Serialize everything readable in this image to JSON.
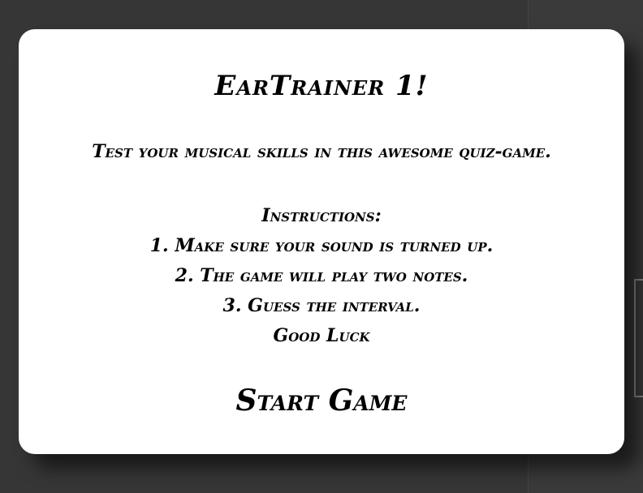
{
  "game": {
    "title": "EarTrainer 1!",
    "tagline": "Test your musical skills in this awesome quiz-game.",
    "instructions": {
      "heading": "Instructions:",
      "steps": [
        "1. Make sure your sound is turned up.",
        "2. The game will play two notes.",
        "3. Guess the interval."
      ],
      "closing": "Good Luck"
    },
    "start_label": "Start Game"
  },
  "colors": {
    "backdrop": "#363636",
    "modal": "#ffffff",
    "text": "#000000"
  }
}
